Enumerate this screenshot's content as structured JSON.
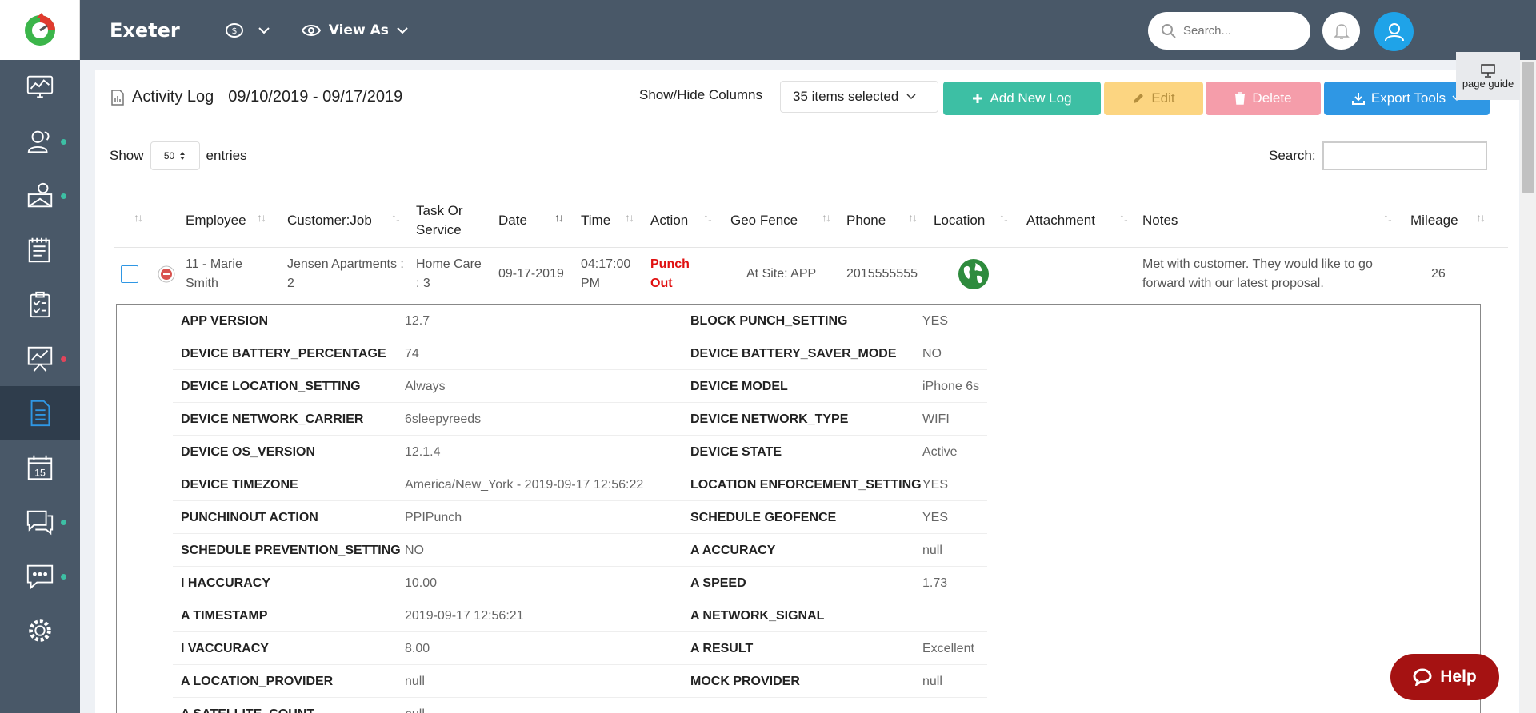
{
  "app": {
    "company": "Exeter",
    "view_as": "View As"
  },
  "search": {
    "placeholder": "Search..."
  },
  "page": {
    "title": "Activity Log",
    "date_range": "09/10/2019 - 09/17/2019",
    "show_hide_label": "Show/Hide Columns",
    "items_selected": "35 items selected",
    "buttons": {
      "add": "Add New Log",
      "edit": "Edit",
      "delete": "Delete",
      "export": "Export Tools"
    },
    "page_guide": "page guide"
  },
  "table_controls": {
    "show_label": "Show",
    "entries_value": "50",
    "entries_label": "entries",
    "search_label": "Search:"
  },
  "columns": [
    "Employee",
    "Customer:Job",
    "Task Or Service",
    "Date",
    "Time",
    "Action",
    "Geo Fence",
    "Phone",
    "Location",
    "Attachment",
    "Notes",
    "Mileage"
  ],
  "row": {
    "employee": "11 - Marie Smith",
    "customer_job": "Jensen Apartments : 2",
    "task": "Home Care : 3",
    "date": "09-17-2019",
    "time": "04:17:00 PM",
    "action": "Punch Out",
    "geo_fence": "At Site: APP",
    "phone": "2015555555",
    "notes": "Met with customer. They would like to go forward with our latest proposal.",
    "mileage": "26"
  },
  "details": [
    [
      "APP VERSION",
      "12.7",
      "BLOCK PUNCH_SETTING",
      "YES"
    ],
    [
      "DEVICE BATTERY_PERCENTAGE",
      "74",
      "DEVICE BATTERY_SAVER_MODE",
      "NO"
    ],
    [
      "DEVICE LOCATION_SETTING",
      "Always",
      "DEVICE MODEL",
      "iPhone 6s"
    ],
    [
      "DEVICE NETWORK_CARRIER",
      "6sleepyreeds",
      "DEVICE NETWORK_TYPE",
      "WIFI"
    ],
    [
      "DEVICE OS_VERSION",
      "12.1.4",
      "DEVICE STATE",
      "Active"
    ],
    [
      "DEVICE TIMEZONE",
      "America/New_York - 2019-09-17 12:56:22",
      "LOCATION ENFORCEMENT_SETTING",
      "YES"
    ],
    [
      "PUNCHINOUT ACTION",
      "PPIPunch",
      "SCHEDULE GEOFENCE",
      "YES"
    ],
    [
      "SCHEDULE PREVENTION_SETTING",
      "NO",
      "A ACCURACY",
      "null"
    ],
    [
      "I HACCURACY",
      "10.00",
      "A SPEED",
      "1.73"
    ],
    [
      "A TIMESTAMP",
      "2019-09-17 12:56:21",
      "A NETWORK_SIGNAL",
      ""
    ],
    [
      "I VACCURACY",
      "8.00",
      "A RESULT",
      "Excellent"
    ],
    [
      "A LOCATION_PROVIDER",
      "null",
      "MOCK PROVIDER",
      "null"
    ],
    [
      "A SATELLITE_COUNT",
      "null",
      "",
      ""
    ]
  ],
  "help": {
    "label": "Help"
  },
  "colors": {
    "nav_bg": "#495868",
    "nav_active": "#2f3d4c",
    "accent_green": "#3dbfa4",
    "accent_yellow": "#fcd581",
    "accent_pink": "#f59daa",
    "accent_blue": "#2f97e4",
    "punch_red": "#e01010",
    "help_red": "#a51212",
    "dot_green": "#3dbfa4",
    "dot_red": "#e0455b"
  },
  "nav_icons": [
    "dashboard-icon",
    "employees-icon",
    "geofence-icon",
    "timesheet-icon",
    "checklist-icon",
    "reports-icon",
    "activity-log-icon",
    "calendar-icon",
    "chat-icon",
    "messages-icon",
    "settings-icon"
  ],
  "calendar_day": "15"
}
